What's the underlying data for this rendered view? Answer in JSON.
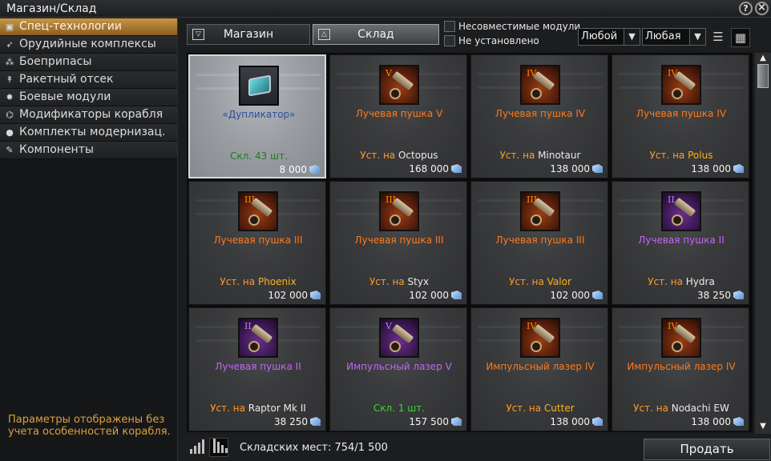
{
  "window": {
    "title": "Магазин/Склад",
    "help_label": "?",
    "close_label": "×"
  },
  "categories": [
    {
      "label": "Спец-технологии",
      "icon": "tech-icon",
      "active": true
    },
    {
      "label": "Орудийные комплексы",
      "icon": "gun-icon",
      "active": false
    },
    {
      "label": "Боеприпасы",
      "icon": "ammo-icon",
      "active": false
    },
    {
      "label": "Ракетный отсек",
      "icon": "rocket-icon",
      "active": false
    },
    {
      "label": "Боевые модули",
      "icon": "gear-icon",
      "active": false
    },
    {
      "label": "Модификаторы корабля",
      "icon": "modifier-icon",
      "active": false
    },
    {
      "label": "Комплекты модернизац.",
      "icon": "dot-icon",
      "active": false
    },
    {
      "label": "Компоненты",
      "icon": "wrench-icon",
      "active": false
    }
  ],
  "note": "Параметры отображены без учета особенностей корабля.",
  "toolbar": {
    "shop_tab": "Магазин",
    "storage_tab": "Склад",
    "filter_incompatible": "Несовместимые модули",
    "filter_not_installed": "Не установлено",
    "dropdown1_value": "Любой",
    "dropdown2_value": "Любая"
  },
  "items": [
    {
      "name": "«Дупликатор»",
      "name_color": "blue",
      "tier": "",
      "icon_kind": "dup",
      "status_prefix": "",
      "status_ship": "",
      "status_ship_color": "",
      "status_text": "Скл. 43 шт.",
      "status_color": "dgreen",
      "price": "8 000",
      "selected": true
    },
    {
      "name": "Лучевая пушка V",
      "name_color": "orange",
      "tier": "V",
      "icon_kind": "orange",
      "status_prefix": "Уст. на",
      "status_ship": "Octopus",
      "status_ship_color": "white",
      "status_text": "",
      "status_color": "",
      "price": "168 000",
      "selected": false
    },
    {
      "name": "Лучевая пушка IV",
      "name_color": "orange",
      "tier": "IV",
      "icon_kind": "orange",
      "status_prefix": "Уст. на",
      "status_ship": "Minotaur",
      "status_ship_color": "white",
      "status_text": "",
      "status_color": "",
      "price": "138 000",
      "selected": false
    },
    {
      "name": "Лучевая пушка IV",
      "name_color": "orange",
      "tier": "IV",
      "icon_kind": "orange",
      "status_prefix": "Уст. на",
      "status_ship": "Polus",
      "status_ship_color": "yellow",
      "status_text": "",
      "status_color": "",
      "price": "138 000",
      "selected": false
    },
    {
      "name": "Лучевая пушка III",
      "name_color": "orange",
      "tier": "III",
      "icon_kind": "orange",
      "status_prefix": "Уст. на",
      "status_ship": "Phoenix",
      "status_ship_color": "yellow",
      "status_text": "",
      "status_color": "",
      "price": "102 000",
      "selected": false
    },
    {
      "name": "Лучевая пушка III",
      "name_color": "orange",
      "tier": "III",
      "icon_kind": "orange",
      "status_prefix": "Уст. на",
      "status_ship": "Styx",
      "status_ship_color": "white",
      "status_text": "",
      "status_color": "",
      "price": "102 000",
      "selected": false
    },
    {
      "name": "Лучевая пушка III",
      "name_color": "orange",
      "tier": "III",
      "icon_kind": "orange",
      "status_prefix": "Уст. на",
      "status_ship": "Valor",
      "status_ship_color": "yellow",
      "status_text": "",
      "status_color": "",
      "price": "102 000",
      "selected": false
    },
    {
      "name": "Лучевая пушка II",
      "name_color": "purple",
      "tier": "II",
      "icon_kind": "purple",
      "status_prefix": "Уст. на",
      "status_ship": "Hydra",
      "status_ship_color": "white",
      "status_text": "",
      "status_color": "",
      "price": "38 250",
      "selected": false
    },
    {
      "name": "Лучевая пушка II",
      "name_color": "purple",
      "tier": "II",
      "icon_kind": "purple",
      "status_prefix": "Уст. на",
      "status_ship": "Raptor Mk II",
      "status_ship_color": "white",
      "status_text": "",
      "status_color": "",
      "price": "38 250",
      "selected": false
    },
    {
      "name": "Импульсный лазер V",
      "name_color": "purple",
      "tier": "V",
      "icon_kind": "purple",
      "status_prefix": "",
      "status_ship": "",
      "status_ship_color": "",
      "status_text": "Скл. 1 шт.",
      "status_color": "green",
      "price": "157 500",
      "selected": false
    },
    {
      "name": "Импульсный лазер IV",
      "name_color": "orange",
      "tier": "IV",
      "icon_kind": "orange",
      "status_prefix": "Уст. на",
      "status_ship": "Cutter",
      "status_ship_color": "yellow",
      "status_text": "",
      "status_color": "",
      "price": "138 000",
      "selected": false
    },
    {
      "name": "Импульсный лазер IV",
      "name_color": "orange",
      "tier": "IV",
      "icon_kind": "orange",
      "status_prefix": "Уст. на",
      "status_ship": "Nodachi EW",
      "status_ship_color": "white",
      "status_text": "",
      "status_color": "",
      "price": "138 000",
      "selected": false
    }
  ],
  "footer": {
    "storage_text": "Складских мест: 754/1 500",
    "sell_label": "Продать"
  },
  "colors": {
    "active_category": "#c79645",
    "name_orange": "#ff7a1c",
    "name_purple": "#c267f0",
    "ship_yellow": "#ffb21a",
    "status_green": "#3ed43e",
    "note_text": "#d9a23f"
  }
}
